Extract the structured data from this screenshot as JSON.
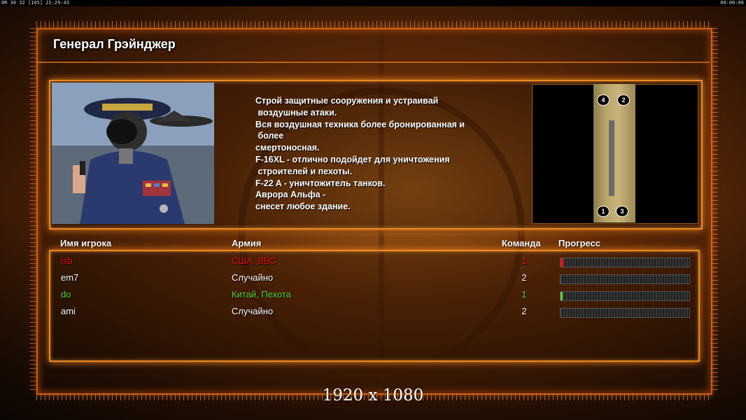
{
  "status_bar": {
    "left_text": "0R 30 32 [165] 21:29:43",
    "right_text": "00:00:00"
  },
  "general": {
    "title": "Генерал Грэйнджер",
    "description": "Строй защитные сооружения и устраивай\n воздушные атаки.\nВся воздушная техника более бронированная и\n более\nсмертоносная.\nF-16XL - отлично подойдет для уничтожения\n строителей и пехоты.\nF-22 A - уничтожитель танков.\nАврора Альфа -\nснесет любое здание."
  },
  "minimap": {
    "markers": [
      "4",
      "2",
      "1",
      "3"
    ]
  },
  "players_table": {
    "headers": {
      "name": "Имя игрока",
      "army": "Армия",
      "team": "Команда",
      "progress": "Прогресс"
    },
    "rows": [
      {
        "name": "isb",
        "army": "США, ВВС",
        "team": "1",
        "progress": 0.02,
        "color": "#e01010"
      },
      {
        "name": "em7",
        "army": "Случайно",
        "team": "2",
        "progress": 0,
        "color": "#ffffff"
      },
      {
        "name": "do",
        "army": "Китай, Пехота",
        "team": "1",
        "progress": 0.01,
        "color": "#5ed43a"
      },
      {
        "name": "ami",
        "army": "Случайно",
        "team": "2",
        "progress": 0,
        "color": "#ffffff"
      }
    ]
  },
  "resolution_caption": "1920 x 1080"
}
